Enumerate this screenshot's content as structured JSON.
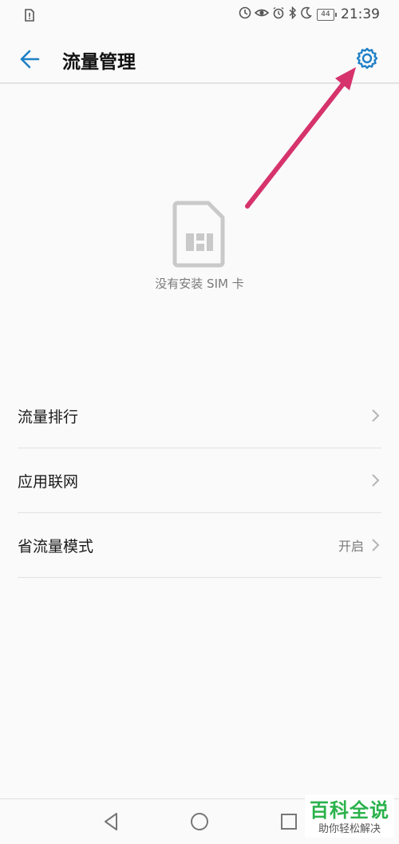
{
  "status_bar": {
    "time": "21:39",
    "battery": "44",
    "icons": [
      "sim-alert-icon",
      "data-saver-icon",
      "eye-comfort-icon",
      "alarm-icon",
      "bluetooth-icon",
      "moon-icon",
      "battery-icon"
    ]
  },
  "app_bar": {
    "title": "流量管理",
    "back_icon": "back-arrow-icon",
    "settings_icon": "gear-icon"
  },
  "empty_state": {
    "icon": "sim-card-icon",
    "text": "没有安装 SIM 卡"
  },
  "menu": {
    "items": [
      {
        "label": "流量排行",
        "value": ""
      },
      {
        "label": "应用联网",
        "value": ""
      },
      {
        "label": "省流量模式",
        "value": "开启"
      }
    ]
  },
  "nav_bar": {
    "icons": [
      "nav-back-icon",
      "nav-home-icon",
      "nav-recents-icon"
    ]
  },
  "watermark": {
    "title": "百科全说",
    "subtitle": "助你轻松解决"
  },
  "colors": {
    "accent": "#1e7fc6",
    "annotation_arrow": "#d6336c",
    "watermark_green": "#2bb24c"
  }
}
